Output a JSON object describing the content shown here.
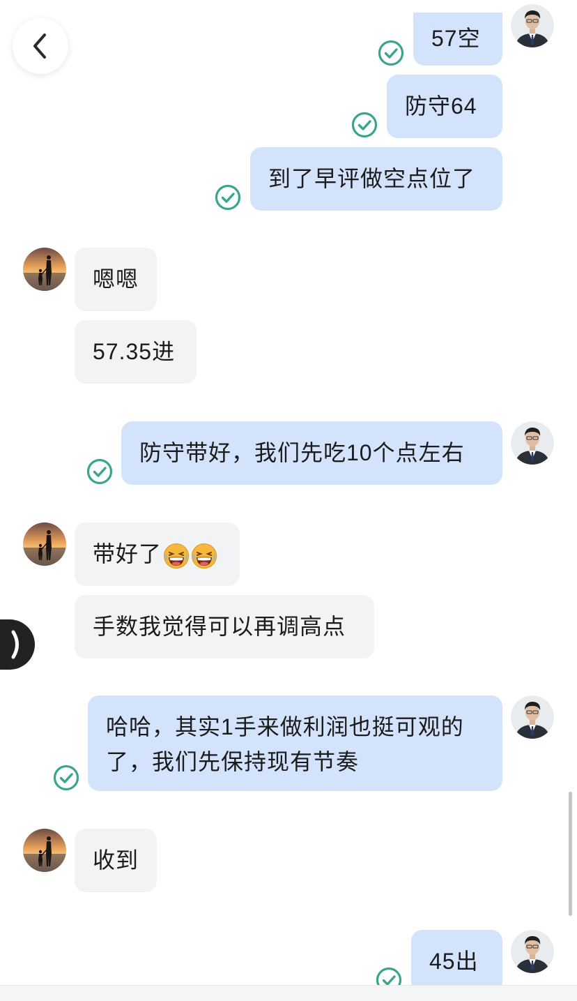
{
  "messages": [
    {
      "side": "out",
      "text": "57空"
    },
    {
      "side": "out",
      "text": "防守64"
    },
    {
      "side": "out",
      "text": "到了早评做空点位了"
    },
    {
      "side": "in",
      "text": "嗯嗯"
    },
    {
      "side": "in",
      "text": "57.35进"
    },
    {
      "side": "out",
      "text": "防守带好，我们先吃10个点左右"
    },
    {
      "side": "in",
      "text": "带好了",
      "emoji": [
        "laughing-emoji",
        "laughing-emoji"
      ]
    },
    {
      "side": "in",
      "text": "手数我觉得可以再调高点"
    },
    {
      "side": "out",
      "line1": "哈哈，其实1手来做利润也挺可观的",
      "line2": "了，我们先保持现有节奏"
    },
    {
      "side": "in",
      "text": "收到"
    },
    {
      "side": "out",
      "text": "45出"
    }
  ],
  "icons": {
    "back": "chevron-left-icon",
    "sent_status": "check-circle-icon",
    "side_tab": "chevron-right-icon"
  },
  "colors": {
    "outgoing_bubble": "#d4e3fc",
    "incoming_bubble": "#f2f3f5",
    "check": "#3aa58a"
  }
}
